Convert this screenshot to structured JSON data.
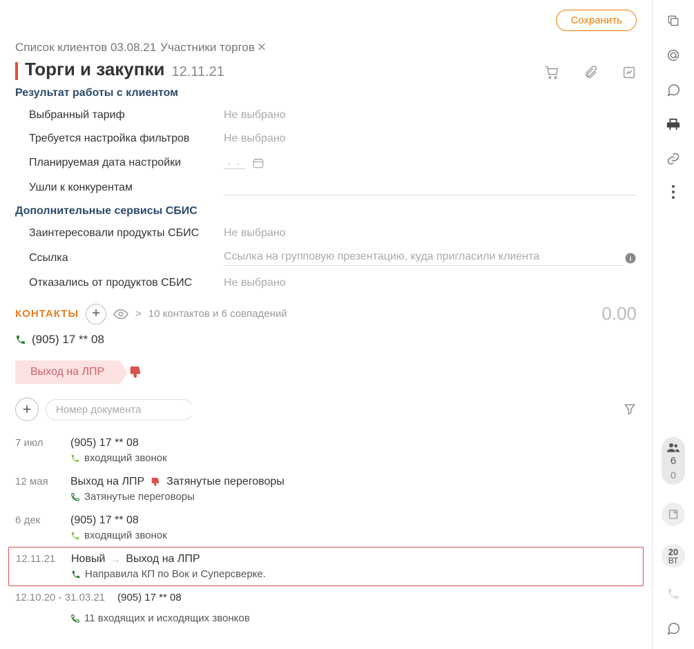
{
  "header": {
    "save_label": "Сохранить",
    "breadcrumb1": "Список клиентов 03.08.21",
    "breadcrumb2": "Участники торгов",
    "title": "Торги и закупки",
    "title_date": "12.11.21"
  },
  "section1": {
    "heading": "Результат работы с клиентом",
    "rows": {
      "tariff_label": "Выбранный тариф",
      "tariff_value": "Не выбрано",
      "filters_label": "Требуется настройка фильтров",
      "filters_value": "Не выбрано",
      "plan_date_label": "Планируемая дата настройки",
      "plan_date_value": ".   .",
      "competitors_label": "Ушли к конкурентам"
    }
  },
  "section2": {
    "heading": "Дополнительные сервисы СБИС",
    "rows": {
      "interested_label": "Заинтересовали продукты СБИС",
      "interested_value": "Не выбрано",
      "link_label": "Ссылка",
      "link_placeholder": "Ссылка на групповую презентацию, куда пригласили клиента",
      "refused_label": "Отказались от продуктов СБИС",
      "refused_value": "Не выбрано"
    }
  },
  "contacts": {
    "heading": "КОНТАКТЫ",
    "hint": "10 контактов и 6 совпадений",
    "gt": ">",
    "amount": "0.00",
    "phone": "(905) 17 ** 08"
  },
  "stage": {
    "label": "Выход на ЛПР"
  },
  "filters": {
    "search_placeholder": "Номер документа"
  },
  "log": {
    "r1": {
      "date": "7 июл",
      "phone": "(905) 17 ** 08",
      "sub": "входящий звонок"
    },
    "r2": {
      "date": "12 мая",
      "st1": "Выход на ЛПР",
      "st2": "Затянутые переговоры",
      "sub": "Затянутые переговоры"
    },
    "r3": {
      "date": "6 дек",
      "phone": "(905) 17 ** 08",
      "sub": "входящий звонок"
    },
    "r4": {
      "date": "12.11.21",
      "st1": "Новый",
      "st2": "Выход на ЛПР",
      "sub": "Направила КП по Вок и Суперсверке."
    },
    "r5": {
      "range": "12.10.20 - 31.03.21",
      "phone": "(905) 17 ** 08",
      "sub": "11 входящих и исходящих звонков"
    }
  },
  "sidebar": {
    "badge_count": "6",
    "badge_zero": "0",
    "cal_day": "20",
    "cal_dow": "ВТ"
  }
}
